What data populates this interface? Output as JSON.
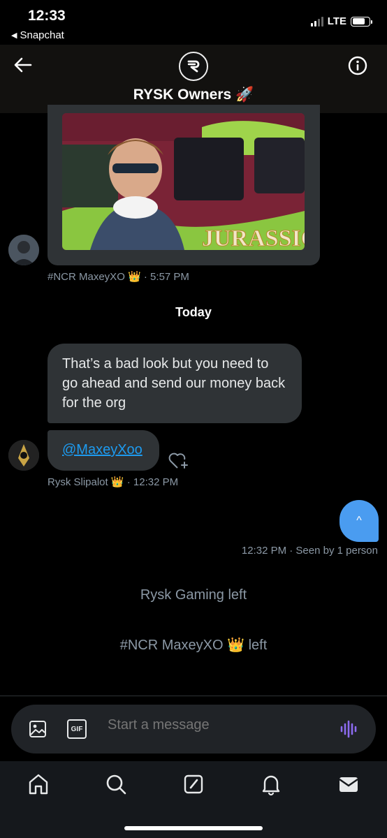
{
  "status_bar": {
    "time": "12:33",
    "back_app": "Snapchat",
    "network": "LTE",
    "battery_level": 0.75
  },
  "header": {
    "title": "RYSK Owners",
    "title_emoji": "🚀",
    "back_icon": "arrow-left-icon",
    "info_icon": "info-icon"
  },
  "messages": [
    {
      "type": "image",
      "sender": "#NCR MaxeyXO",
      "sender_emoji": "👑",
      "time": "· 5:57 PM",
      "image_text": "JURASSIC P"
    },
    {
      "type": "day_divider",
      "text": "Today"
    },
    {
      "type": "text",
      "text": "That’s a bad look but you need to go ahead and send our money back for the org"
    },
    {
      "type": "mention",
      "text": "@MaxeyXoo",
      "sender": "Rysk Slipalot",
      "sender_emoji": "👑",
      "time": "· 12:32 PM"
    },
    {
      "type": "sent",
      "text": "^",
      "meta": "12:32 PM · Seen by 1 person"
    }
  ],
  "system_messages": [
    {
      "text": "Rysk Gaming left"
    },
    {
      "name": "#NCR MaxeyXO",
      "emoji": "👑",
      "suffix": "left"
    }
  ],
  "composer": {
    "placeholder": "Start a message",
    "gif_label": "GIF"
  },
  "tabs": [
    "home-icon",
    "search-icon",
    "compose-icon",
    "notifications-icon",
    "messages-icon"
  ]
}
